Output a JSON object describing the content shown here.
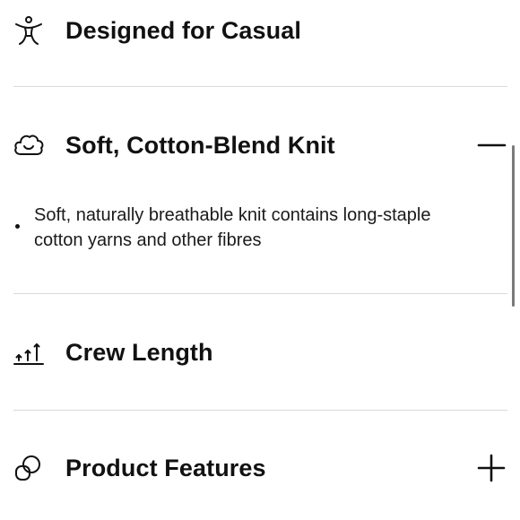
{
  "sections": [
    {
      "icon": "accessibility-person-icon",
      "title": "Designed for Casual"
    },
    {
      "icon": "cloud-smile-icon",
      "title": "Soft, Cotton-Blend Knit",
      "toggle": "collapse-minus-icon",
      "expanded": true,
      "bullets": [
        "Soft, naturally breathable knit contains long-staple cotton yarns and other fibres"
      ]
    },
    {
      "icon": "crew-length-arrows-icon",
      "title": "Crew Length"
    },
    {
      "icon": "interlocking-shapes-icon",
      "title": "Product Features",
      "toggle": "expand-plus-icon",
      "expanded": false
    }
  ]
}
